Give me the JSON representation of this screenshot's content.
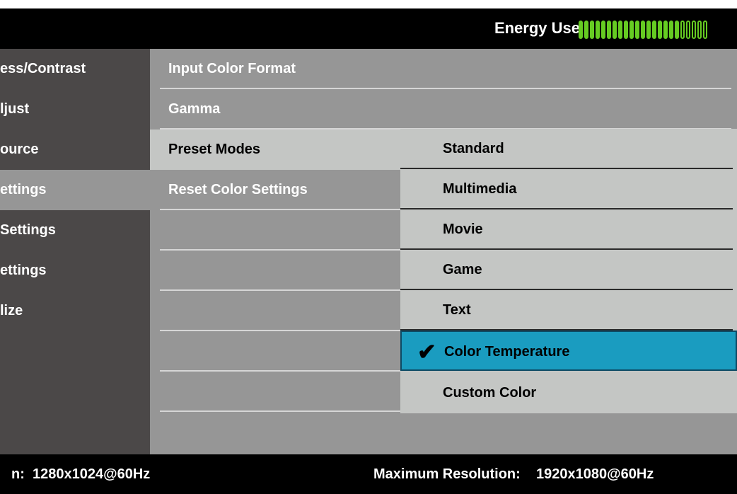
{
  "header": {
    "energy_label": "Energy Use",
    "energy_level": 0.78,
    "energy_segments_on": 18,
    "energy_segments_off": 5
  },
  "leftnav": {
    "items": [
      {
        "label": "ess/Contrast",
        "active": false
      },
      {
        "label": "ljust",
        "active": false
      },
      {
        "label": "ource",
        "active": false
      },
      {
        "label": "ettings",
        "active": true
      },
      {
        "label": "Settings",
        "active": false
      },
      {
        "label": "ettings",
        "active": false
      },
      {
        "label": "lize",
        "active": false
      }
    ]
  },
  "menu": {
    "items": [
      {
        "label": "Input Color Format"
      },
      {
        "label": "Gamma"
      },
      {
        "label": "Preset Modes"
      },
      {
        "label": "Reset Color Settings"
      }
    ]
  },
  "submenu": {
    "items": [
      {
        "label": "Standard"
      },
      {
        "label": "Multimedia"
      },
      {
        "label": "Movie"
      },
      {
        "label": "Game"
      },
      {
        "label": "Text"
      },
      {
        "label": "Color Temperature",
        "selected": true
      },
      {
        "label": "Custom Color"
      }
    ],
    "check_glyph": "✔"
  },
  "footer": {
    "current_resolution": "n:  1280x1024@60Hz",
    "max_resolution": "Maximum Resolution:    1920x1080@60Hz"
  },
  "colors": {
    "accent": "#1a9cc0",
    "meter": "#66cc22",
    "panel": "#969696",
    "nav": "#4b4848"
  }
}
